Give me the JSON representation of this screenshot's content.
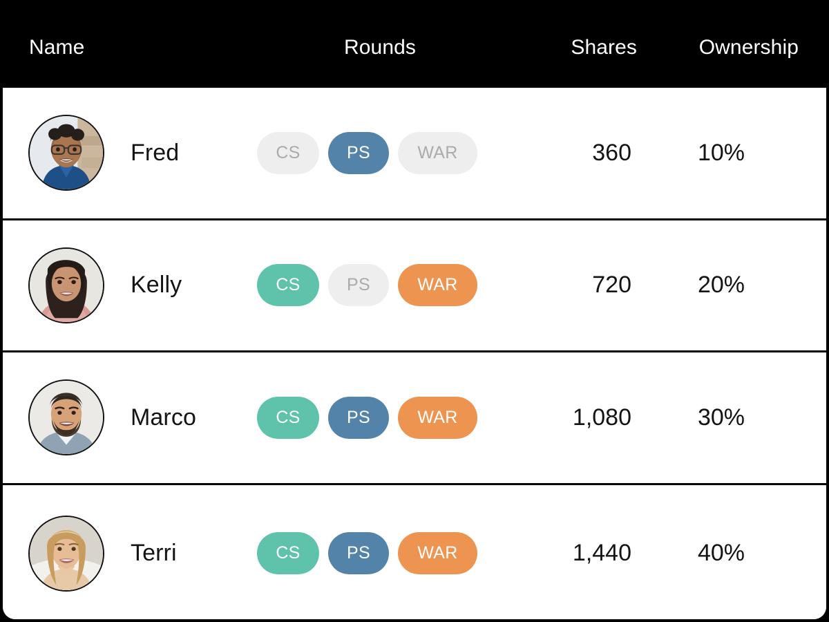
{
  "header": {
    "columns": [
      {
        "key": "name",
        "label": "Name"
      },
      {
        "key": "rounds",
        "label": "Rounds"
      },
      {
        "key": "shares",
        "label": "Shares"
      },
      {
        "key": "ownership",
        "label": "Ownership"
      }
    ],
    "name_label": "Name",
    "rounds_label": "Rounds",
    "shares_label": "Shares",
    "ownership_label": "Ownership",
    "background_color": "#000000",
    "text_color": "#ffffff"
  },
  "colors": {
    "cs_active": "#5fc2ab",
    "ps_active": "#5383a8",
    "war_active": "#ed9550",
    "badge_inactive_bg": "#eeeeee",
    "badge_inactive_text": "#ababab",
    "row_background": "#ffffff",
    "row_text": "#141414",
    "border": "#000000"
  },
  "round_labels": {
    "cs": "CS",
    "ps": "PS",
    "war": "WAR"
  },
  "rows": [
    {
      "name": "Fred",
      "avatar": "avatar-fred",
      "rounds": {
        "cs": "CS",
        "ps": "PS",
        "war": "WAR"
      },
      "rounds_active": {
        "cs": false,
        "ps": true,
        "war": false
      },
      "shares": "360",
      "ownership": "10%"
    },
    {
      "name": "Kelly",
      "avatar": "avatar-kelly",
      "rounds": {
        "cs": "CS",
        "ps": "PS",
        "war": "WAR"
      },
      "rounds_active": {
        "cs": true,
        "ps": false,
        "war": true
      },
      "shares": "720",
      "ownership": "20%"
    },
    {
      "name": "Marco",
      "avatar": "avatar-marco",
      "rounds": {
        "cs": "CS",
        "ps": "PS",
        "war": "WAR"
      },
      "rounds_active": {
        "cs": true,
        "ps": true,
        "war": true
      },
      "shares": "1,080",
      "ownership": "30%"
    },
    {
      "name": "Terri",
      "avatar": "avatar-terri",
      "rounds": {
        "cs": "CS",
        "ps": "PS",
        "war": "WAR"
      },
      "rounds_active": {
        "cs": true,
        "ps": true,
        "war": true
      },
      "shares": "1,440",
      "ownership": "40%"
    }
  ]
}
